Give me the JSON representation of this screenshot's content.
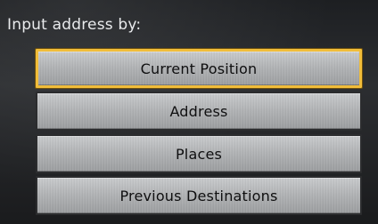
{
  "prompt": {
    "label": "Input address by:"
  },
  "menu": {
    "selected_index": 0,
    "items": [
      {
        "label": "Current Position"
      },
      {
        "label": "Address"
      },
      {
        "label": "Places"
      },
      {
        "label": "Previous Destinations"
      }
    ]
  },
  "colors": {
    "selection_border": "#f1bd3a",
    "background": "#2c2e31",
    "button_face": "#b2b4b6"
  }
}
